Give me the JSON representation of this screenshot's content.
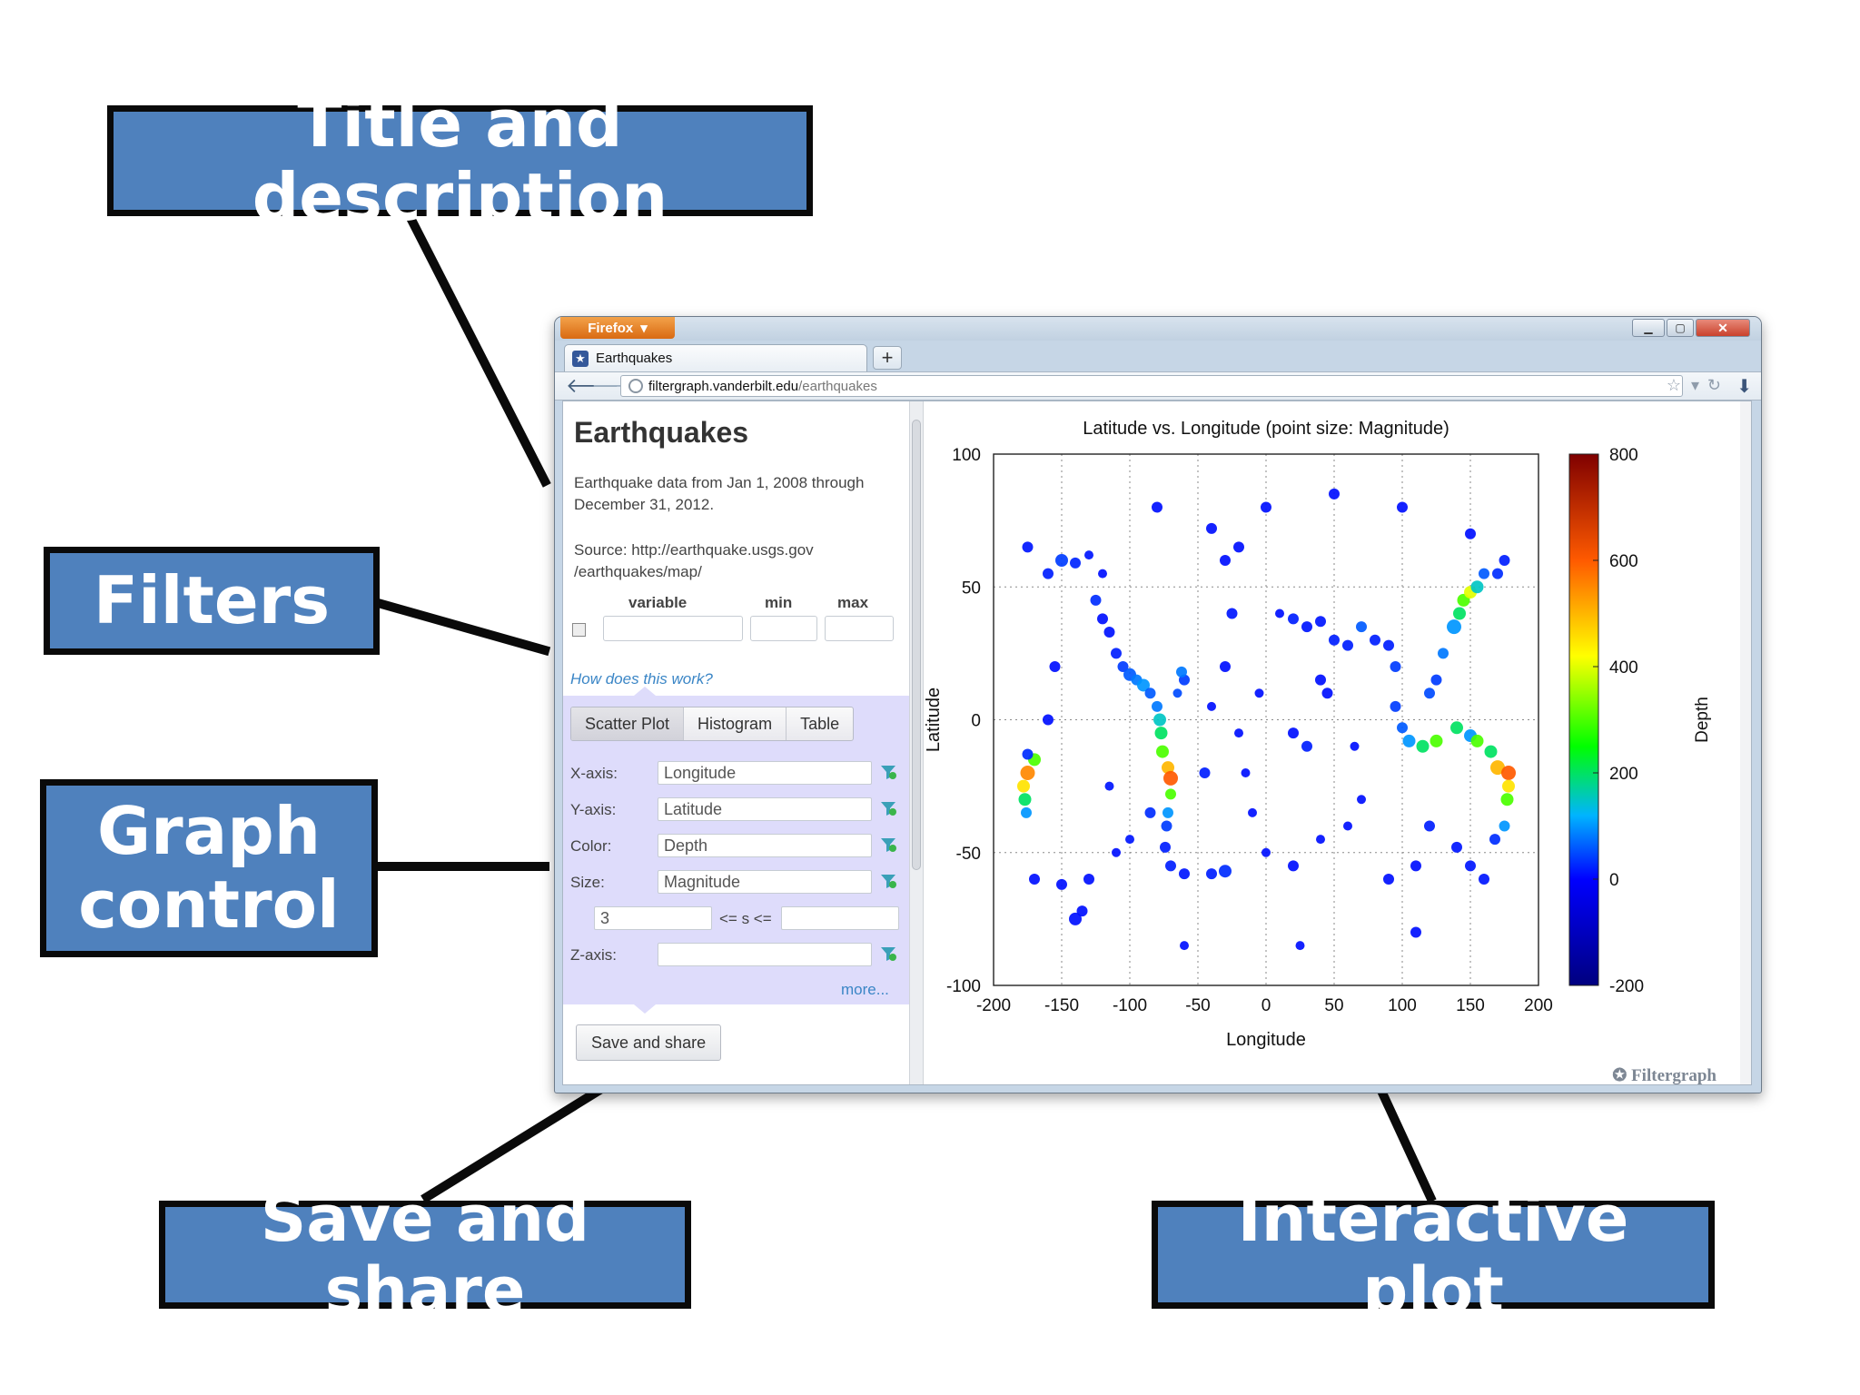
{
  "callouts": {
    "title_desc": "Title and description",
    "filters": "Filters",
    "graph_control_line1": "Graph",
    "graph_control_line2": "control",
    "save_share": "Save and share",
    "interactive_plot": "Interactive plot"
  },
  "browser": {
    "menu_button": "Firefox",
    "tab_title": "Earthquakes",
    "url_domain": "filtergraph.vanderbilt.edu",
    "url_path": "/earthquakes"
  },
  "sidebar": {
    "title": "Earthquakes",
    "description": "Earthquake data from Jan 1, 2008 through December 31, 2012.",
    "source": "Source: http://earthquake.usgs.gov /earthquakes/map/",
    "filter_headers": {
      "variable": "variable",
      "min": "min",
      "max": "max"
    },
    "help_link": "How does this work?",
    "tabs": [
      "Scatter Plot",
      "Histogram",
      "Table"
    ],
    "fields": {
      "x_label": "X-axis:",
      "x_value": "Longitude",
      "y_label": "Y-axis:",
      "y_value": "Latitude",
      "color_label": "Color:",
      "color_value": "Depth",
      "size_label": "Size:",
      "size_value": "Magnitude",
      "size_min": "3",
      "size_range_label": "<= s <=",
      "z_label": "Z-axis:"
    },
    "more_link": "more...",
    "save_button": "Save and share"
  },
  "chart_data": {
    "type": "scatter",
    "title": "Latitude vs. Longitude (point size: Magnitude)",
    "xlabel": "Longitude",
    "ylabel": "Latitude",
    "xlim": [
      -200,
      200
    ],
    "ylim": [
      -100,
      100
    ],
    "x_ticks": [
      -200,
      -150,
      -100,
      -50,
      0,
      50,
      100,
      150,
      200
    ],
    "y_ticks": [
      -100,
      -50,
      0,
      50,
      100
    ],
    "grid": true,
    "colorbar": {
      "label": "Depth",
      "range": [
        -200,
        800
      ],
      "ticks": [
        -200,
        0,
        200,
        400,
        600,
        800
      ]
    },
    "series": [
      {
        "values": [
          {
            "x": -160,
            "y": 55,
            "c": 20,
            "s": 6
          },
          {
            "x": -150,
            "y": 60,
            "c": 40,
            "s": 7
          },
          {
            "x": -140,
            "y": 59,
            "c": 25,
            "s": 6
          },
          {
            "x": -130,
            "y": 62,
            "c": 15,
            "s": 5
          },
          {
            "x": -120,
            "y": 55,
            "c": 10,
            "s": 5
          },
          {
            "x": -125,
            "y": 45,
            "c": 30,
            "s": 6
          },
          {
            "x": -120,
            "y": 38,
            "c": 10,
            "s": 6
          },
          {
            "x": -115,
            "y": 33,
            "c": 12,
            "s": 6
          },
          {
            "x": -110,
            "y": 25,
            "c": 20,
            "s": 6
          },
          {
            "x": -105,
            "y": 20,
            "c": 40,
            "s": 6
          },
          {
            "x": -100,
            "y": 17,
            "c": 60,
            "s": 7
          },
          {
            "x": -95,
            "y": 15,
            "c": 80,
            "s": 6
          },
          {
            "x": -90,
            "y": 13,
            "c": 100,
            "s": 7
          },
          {
            "x": -85,
            "y": 10,
            "c": 60,
            "s": 6
          },
          {
            "x": -80,
            "y": 5,
            "c": 80,
            "s": 6
          },
          {
            "x": -78,
            "y": 0,
            "c": 150,
            "s": 7
          },
          {
            "x": -77,
            "y": -5,
            "c": 200,
            "s": 7
          },
          {
            "x": -76,
            "y": -12,
            "c": 300,
            "s": 7
          },
          {
            "x": -72,
            "y": -18,
            "c": 500,
            "s": 7
          },
          {
            "x": -70,
            "y": -22,
            "c": 600,
            "s": 8
          },
          {
            "x": -70,
            "y": -28,
            "c": 300,
            "s": 6
          },
          {
            "x": -72,
            "y": -35,
            "c": 100,
            "s": 6
          },
          {
            "x": -73,
            "y": -40,
            "c": 40,
            "s": 6
          },
          {
            "x": -74,
            "y": -48,
            "c": 20,
            "s": 6
          },
          {
            "x": -70,
            "y": -55,
            "c": 20,
            "s": 6
          },
          {
            "x": -60,
            "y": -58,
            "c": 15,
            "s": 6
          },
          {
            "x": -40,
            "y": -58,
            "c": 20,
            "s": 6
          },
          {
            "x": -30,
            "y": -57,
            "c": 30,
            "s": 7
          },
          {
            "x": -60,
            "y": 15,
            "c": 40,
            "s": 6
          },
          {
            "x": -62,
            "y": 18,
            "c": 80,
            "s": 6
          },
          {
            "x": -65,
            "y": 10,
            "c": 50,
            "s": 5
          },
          {
            "x": -170,
            "y": -15,
            "c": 300,
            "s": 7
          },
          {
            "x": -175,
            "y": -20,
            "c": 550,
            "s": 8
          },
          {
            "x": -178,
            "y": -25,
            "c": 450,
            "s": 7
          },
          {
            "x": -177,
            "y": -30,
            "c": 200,
            "s": 7
          },
          {
            "x": -176,
            "y": -35,
            "c": 100,
            "s": 6
          },
          {
            "x": -175,
            "y": -13,
            "c": 30,
            "s": 6
          },
          {
            "x": -30,
            "y": 60,
            "c": 10,
            "s": 6
          },
          {
            "x": -20,
            "y": 65,
            "c": 10,
            "s": 6
          },
          {
            "x": -25,
            "y": 40,
            "c": 15,
            "s": 6
          },
          {
            "x": -30,
            "y": 20,
            "c": 10,
            "s": 6
          },
          {
            "x": -40,
            "y": 5,
            "c": 10,
            "s": 5
          },
          {
            "x": -20,
            "y": -5,
            "c": 10,
            "s": 5
          },
          {
            "x": -15,
            "y": -20,
            "c": 10,
            "s": 5
          },
          {
            "x": -10,
            "y": -35,
            "c": 10,
            "s": 5
          },
          {
            "x": 0,
            "y": -50,
            "c": 10,
            "s": 5
          },
          {
            "x": 20,
            "y": -55,
            "c": 10,
            "s": 6
          },
          {
            "x": 40,
            "y": -45,
            "c": 10,
            "s": 5
          },
          {
            "x": 60,
            "y": -40,
            "c": 10,
            "s": 5
          },
          {
            "x": 70,
            "y": -30,
            "c": 10,
            "s": 5
          },
          {
            "x": 65,
            "y": -10,
            "c": 10,
            "s": 5
          },
          {
            "x": 10,
            "y": 40,
            "c": 10,
            "s": 5
          },
          {
            "x": 20,
            "y": 38,
            "c": 20,
            "s": 6
          },
          {
            "x": 30,
            "y": 35,
            "c": 15,
            "s": 6
          },
          {
            "x": 40,
            "y": 37,
            "c": 15,
            "s": 6
          },
          {
            "x": 50,
            "y": 30,
            "c": 20,
            "s": 6
          },
          {
            "x": 60,
            "y": 28,
            "c": 20,
            "s": 6
          },
          {
            "x": 70,
            "y": 35,
            "c": 60,
            "s": 6
          },
          {
            "x": 80,
            "y": 30,
            "c": 20,
            "s": 6
          },
          {
            "x": 90,
            "y": 28,
            "c": 20,
            "s": 6
          },
          {
            "x": 95,
            "y": 20,
            "c": 40,
            "s": 6
          },
          {
            "x": 95,
            "y": 5,
            "c": 40,
            "s": 6
          },
          {
            "x": 100,
            "y": -3,
            "c": 60,
            "s": 6
          },
          {
            "x": 105,
            "y": -8,
            "c": 100,
            "s": 7
          },
          {
            "x": 115,
            "y": -10,
            "c": 200,
            "s": 7
          },
          {
            "x": 125,
            "y": -8,
            "c": 300,
            "s": 7
          },
          {
            "x": 120,
            "y": 10,
            "c": 50,
            "s": 6
          },
          {
            "x": 125,
            "y": 15,
            "c": 40,
            "s": 6
          },
          {
            "x": 130,
            "y": 25,
            "c": 80,
            "s": 6
          },
          {
            "x": 138,
            "y": 35,
            "c": 100,
            "s": 8
          },
          {
            "x": 142,
            "y": 40,
            "c": 200,
            "s": 7
          },
          {
            "x": 145,
            "y": 45,
            "c": 300,
            "s": 7
          },
          {
            "x": 150,
            "y": 48,
            "c": 400,
            "s": 7
          },
          {
            "x": 155,
            "y": 50,
            "c": 150,
            "s": 7
          },
          {
            "x": 160,
            "y": 55,
            "c": 60,
            "s": 6
          },
          {
            "x": 170,
            "y": 55,
            "c": 30,
            "s": 6
          },
          {
            "x": 140,
            "y": -3,
            "c": 200,
            "s": 7
          },
          {
            "x": 150,
            "y": -6,
            "c": 100,
            "s": 7
          },
          {
            "x": 155,
            "y": -8,
            "c": 300,
            "s": 7
          },
          {
            "x": 165,
            "y": -12,
            "c": 200,
            "s": 7
          },
          {
            "x": 170,
            "y": -18,
            "c": 500,
            "s": 8
          },
          {
            "x": 178,
            "y": -20,
            "c": 600,
            "s": 8
          },
          {
            "x": 178,
            "y": -25,
            "c": 450,
            "s": 7
          },
          {
            "x": 177,
            "y": -30,
            "c": 300,
            "s": 7
          },
          {
            "x": 175,
            "y": -40,
            "c": 100,
            "s": 6
          },
          {
            "x": 168,
            "y": -45,
            "c": 30,
            "s": 6
          },
          {
            "x": 120,
            "y": -40,
            "c": 20,
            "s": 6
          },
          {
            "x": 140,
            "y": -48,
            "c": 15,
            "s": 6
          },
          {
            "x": 150,
            "y": -55,
            "c": 15,
            "s": 6
          },
          {
            "x": 160,
            "y": -60,
            "c": 15,
            "s": 6
          },
          {
            "x": 110,
            "y": -55,
            "c": 10,
            "s": 6
          },
          {
            "x": 90,
            "y": -60,
            "c": 10,
            "s": 6
          },
          {
            "x": -130,
            "y": -60,
            "c": 10,
            "s": 6
          },
          {
            "x": -110,
            "y": -50,
            "c": 10,
            "s": 5
          },
          {
            "x": -150,
            "y": -62,
            "c": 10,
            "s": 6
          },
          {
            "x": -170,
            "y": -60,
            "c": 10,
            "s": 6
          },
          {
            "x": -140,
            "y": -75,
            "c": 10,
            "s": 7
          },
          {
            "x": -135,
            "y": -72,
            "c": 10,
            "s": 6
          },
          {
            "x": -160,
            "y": 0,
            "c": 10,
            "s": 6
          },
          {
            "x": -155,
            "y": 20,
            "c": 10,
            "s": 6
          },
          {
            "x": 20,
            "y": -5,
            "c": 10,
            "s": 6
          },
          {
            "x": 30,
            "y": -10,
            "c": 20,
            "s": 6
          },
          {
            "x": 40,
            "y": 15,
            "c": 10,
            "s": 6
          },
          {
            "x": 45,
            "y": 10,
            "c": 10,
            "s": 6
          },
          {
            "x": 0,
            "y": 80,
            "c": 10,
            "s": 6
          },
          {
            "x": 50,
            "y": 85,
            "c": 10,
            "s": 6
          },
          {
            "x": 100,
            "y": 80,
            "c": 10,
            "s": 6
          },
          {
            "x": -80,
            "y": 80,
            "c": 10,
            "s": 6
          },
          {
            "x": -40,
            "y": 72,
            "c": 10,
            "s": 6
          },
          {
            "x": 150,
            "y": 70,
            "c": 10,
            "s": 6
          },
          {
            "x": 175,
            "y": 60,
            "c": 20,
            "s": 6
          },
          {
            "x": -175,
            "y": 65,
            "c": 15,
            "s": 6
          },
          {
            "x": 110,
            "y": -80,
            "c": 10,
            "s": 6
          },
          {
            "x": 25,
            "y": -85,
            "c": 10,
            "s": 5
          },
          {
            "x": -60,
            "y": -85,
            "c": 10,
            "s": 5
          },
          {
            "x": -100,
            "y": -45,
            "c": 15,
            "s": 5
          },
          {
            "x": -5,
            "y": 10,
            "c": 10,
            "s": 5
          },
          {
            "x": -45,
            "y": -20,
            "c": 20,
            "s": 6
          },
          {
            "x": -85,
            "y": -35,
            "c": 30,
            "s": 6
          },
          {
            "x": -115,
            "y": -25,
            "c": 15,
            "s": 5
          }
        ]
      }
    ]
  },
  "watermark": "Filtergraph"
}
